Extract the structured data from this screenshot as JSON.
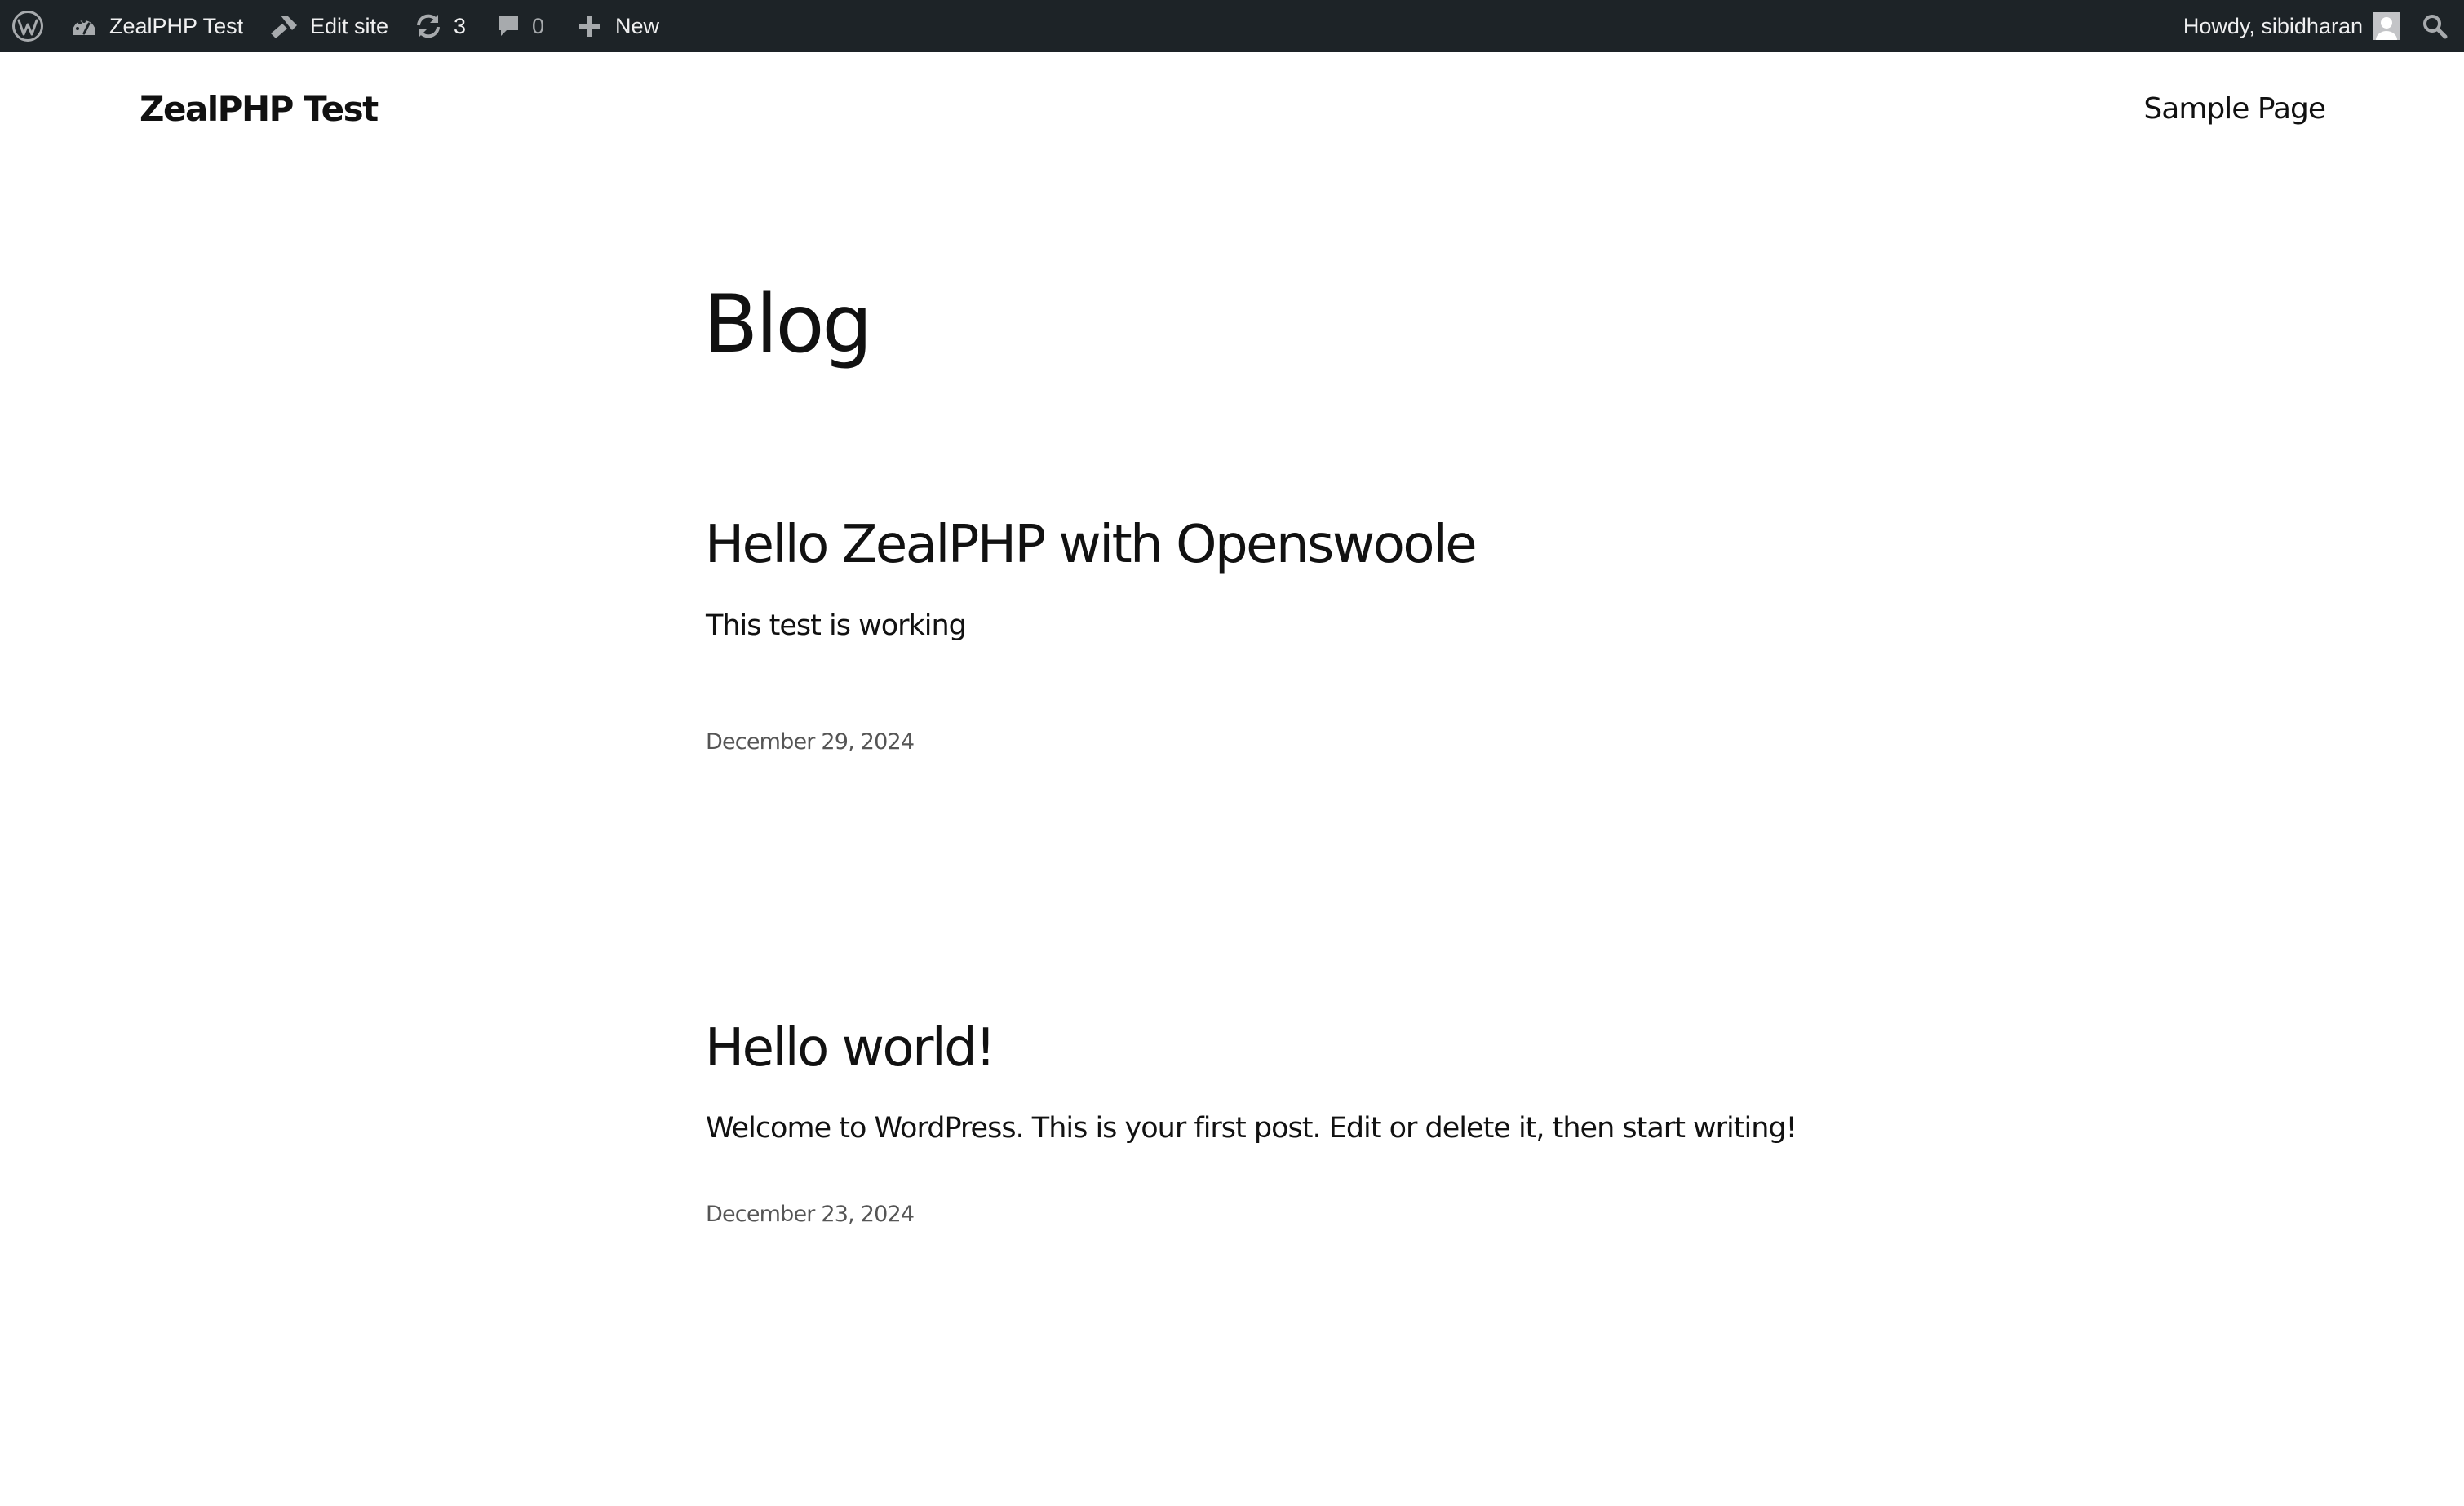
{
  "admin_bar": {
    "site_name": "ZealPHP Test",
    "edit_site_label": "Edit site",
    "updates_count": "3",
    "comments_count": "0",
    "new_label": "New",
    "greeting": "Howdy, sibidharan",
    "icons": {
      "wp": "wordpress-logo-icon",
      "site": "dashboard-icon",
      "edit": "brush-icon",
      "updates": "refresh-icon",
      "comments": "comment-bubble-icon",
      "new": "plus-icon",
      "avatar": "avatar",
      "search": "search-icon"
    },
    "colors": {
      "background": "#1d2327",
      "text": "#f0f0f1",
      "muted": "#a7aaad"
    }
  },
  "header": {
    "site_title": "ZealPHP Test",
    "nav": [
      "Sample Page"
    ]
  },
  "main": {
    "page_title": "Blog",
    "posts": [
      {
        "title": "Hello ZealPHP with Openswoole",
        "excerpt": "This test is working",
        "date": "December 29, 2024"
      },
      {
        "title": "Hello world!",
        "excerpt": "Welcome to WordPress. This is your first post. Edit or delete it, then start writing!",
        "date": "December 23, 2024"
      }
    ]
  }
}
